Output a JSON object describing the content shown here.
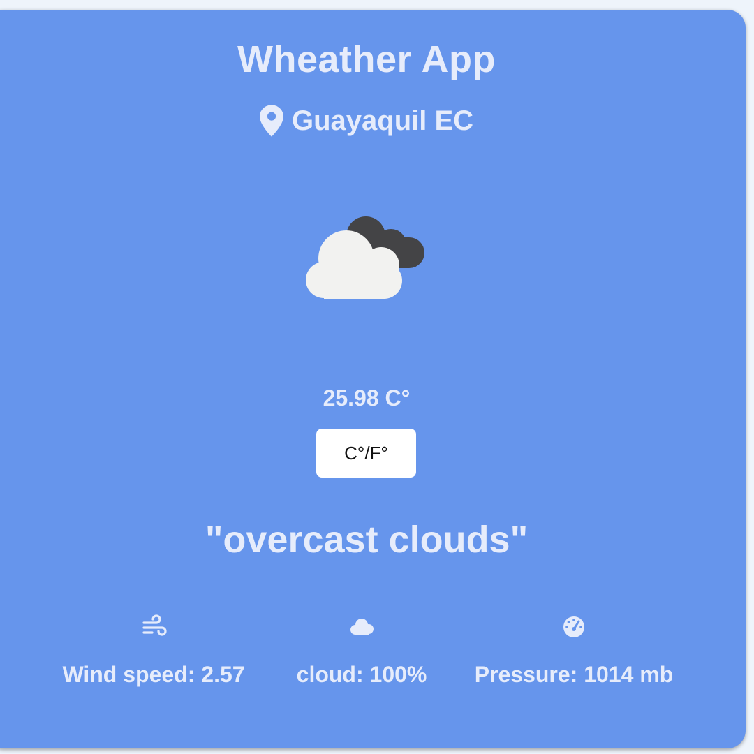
{
  "app": {
    "title": "Wheather App",
    "location": "Guayaquil EC"
  },
  "weather": {
    "icon": "overcast-clouds-icon",
    "temperature": "25.98 C°",
    "unit_toggle_label": "C°/F°",
    "description": "\"overcast clouds\""
  },
  "stats": {
    "wind": {
      "icon": "wind-icon",
      "label": "Wind speed: 2.57"
    },
    "cloud": {
      "icon": "cloud-icon",
      "label": "cloud: 100%"
    },
    "pressure": {
      "icon": "gauge-icon",
      "label": "Pressure: 1014 mb"
    }
  },
  "colors": {
    "card_background": "#6695ec",
    "text": "#e6ecfb",
    "button_background": "#ffffff"
  }
}
